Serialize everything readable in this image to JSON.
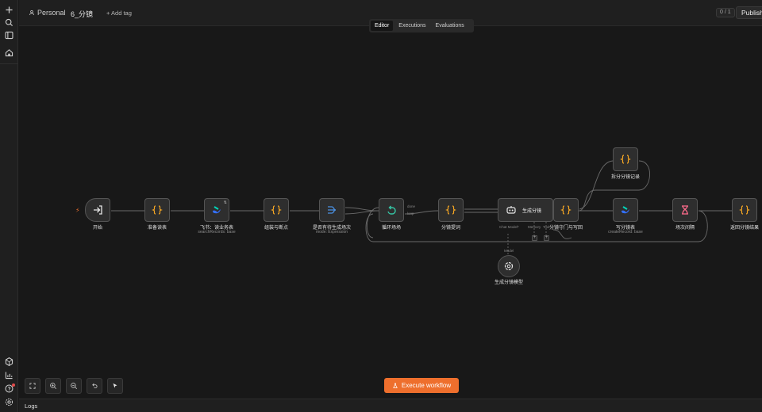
{
  "colors": {
    "accent": "#ee6f2d",
    "node_border": "#545454",
    "edge": "#6a6a6a",
    "code_icon": "#f5a623",
    "loop_icon": "#35c6a5",
    "wait_icon": "#ff6b8b",
    "filter_icon": "#4a90e2"
  },
  "sidebar": {
    "items": [
      {
        "icon": "plus-icon"
      },
      {
        "icon": "search-icon"
      },
      {
        "icon": "panel-icon"
      },
      {
        "icon": "home-icon"
      },
      {
        "icon": "templates-icon"
      },
      {
        "icon": "insights-icon"
      },
      {
        "icon": "help-icon"
      },
      {
        "icon": "settings-icon"
      }
    ]
  },
  "header": {
    "project": "Personal",
    "workflow_name": "6_分镜",
    "add_tag": "+ Add tag",
    "version": "0 / 1",
    "publish": "Publish"
  },
  "tabs": [
    {
      "label": "Editor",
      "active": true
    },
    {
      "label": "Executions",
      "active": false
    },
    {
      "label": "Evaluations",
      "active": false
    }
  ],
  "nodes": {
    "start": {
      "label": "开始",
      "icon": "sign-in-icon"
    },
    "prep_table": {
      "label": "准备读表",
      "icon": "code-braces-icon"
    },
    "feishu_read": {
      "label": "飞书：读业务表",
      "sub": "searchRecords: base",
      "badge": "⇅",
      "icon": "feishu-icon"
    },
    "assemble": {
      "label": "组装与断点",
      "icon": "code-braces-icon"
    },
    "check_pending": {
      "label": "是否有待生成场次",
      "sub": "mode: Expression",
      "icon": "filter-icon"
    },
    "loop": {
      "label": "循环场场",
      "icon": "loop-icon",
      "out_done": "done",
      "out_loop": "loop"
    },
    "storyboard_prompt": {
      "label": "分镜提词",
      "icon": "code-braces-icon"
    },
    "generate": {
      "label": "生成分镜",
      "icon": "robot-icon",
      "port_model": "Chat Model*",
      "port_memory": "Memory",
      "port_tool": "Tool"
    },
    "guard": {
      "label": "分镜守门与写回",
      "icon": "code-braces-icon"
    },
    "split_record": {
      "label": "拆分分镜记录",
      "icon": "code-braces-icon"
    },
    "write_table": {
      "label": "写分镜表",
      "sub": "createRecord: base",
      "icon": "feishu-icon"
    },
    "wait": {
      "label": "场次间隔",
      "icon": "hourglass-icon"
    },
    "return": {
      "label": "返回分镜结果",
      "icon": "code-braces-icon"
    },
    "model": {
      "label": "生成分镜模型",
      "top": "Model",
      "icon": "openai-icon"
    }
  },
  "controls": [
    {
      "name": "fit-view-button",
      "icon": "fit-icon"
    },
    {
      "name": "zoom-in-button",
      "icon": "zoom-in-icon"
    },
    {
      "name": "zoom-out-button",
      "icon": "zoom-out-icon"
    },
    {
      "name": "undo-button",
      "icon": "undo-icon"
    },
    {
      "name": "select-tool-button",
      "icon": "cursor-icon"
    }
  ],
  "execute_button": "Execute workflow",
  "logs_label": "Logs"
}
